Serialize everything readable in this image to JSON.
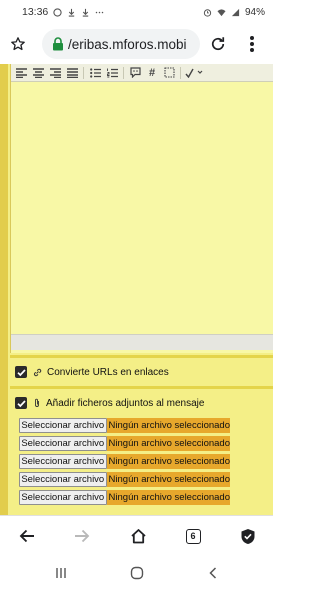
{
  "status_bar": {
    "time": "13:36",
    "left_icons": [
      "whatsapp-icon",
      "download-icon",
      "download-icon",
      "more-dots-icon"
    ],
    "right_icons": [
      "alarm-icon",
      "wifi-icon",
      "signal-icon"
    ],
    "battery_percent": "94%"
  },
  "address_bar": {
    "url": "/eribas.mforos.mobi",
    "secure": true
  },
  "page": {
    "checkbox_urls": {
      "label": "Convierte URLs en enlaces",
      "checked": true
    },
    "checkbox_attachments": {
      "label": "Añadir ficheros adjuntos al mensaje",
      "checked": true
    },
    "file_inputs": [
      {
        "button": "Seleccionar archivo",
        "status": "Ningún archivo seleccionado"
      },
      {
        "button": "Seleccionar archivo",
        "status": "Ningún archivo seleccionado"
      },
      {
        "button": "Seleccionar archivo",
        "status": "Ningún archivo seleccionado"
      },
      {
        "button": "Seleccionar archivo",
        "status": "Ningún archivo seleccionado"
      },
      {
        "button": "Seleccionar archivo",
        "status": "Ningún archivo seleccionado"
      }
    ],
    "toolbar_icons": [
      "align-left-icon",
      "align-center-icon",
      "align-right-icon",
      "align-justify-icon",
      "bullet-list-icon",
      "numbered-list-icon",
      "emoticon-icon",
      "hash-icon",
      "select-all-icon",
      "spellcheck-icon"
    ]
  },
  "bottom_toolbar": {
    "tab_count": "6"
  },
  "colors": {
    "page_bg": "#f4ef87",
    "editor_bg": "#f8f8a6",
    "file_status_bg": "#e7a82c"
  }
}
